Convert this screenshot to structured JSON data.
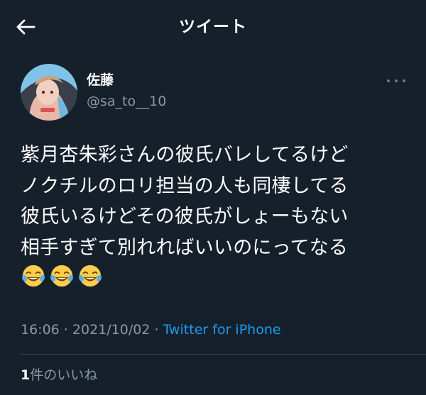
{
  "header": {
    "title": "ツイート",
    "back_icon": "arrow-left-icon"
  },
  "author": {
    "name": "佐藤",
    "handle": "@sa_to__10"
  },
  "tweet": {
    "lines": [
      "紫月杏朱彩さんの彼氏バレしてるけど",
      "ノクチルのロリ担当の人も同棲してる",
      "彼氏いるけどその彼氏がしょーもない",
      "相手すぎて別れればいいのにってなる"
    ],
    "emojis": [
      "face-with-tears-of-joy",
      "face-with-tears-of-joy",
      "face-with-tears-of-joy"
    ]
  },
  "meta": {
    "time": "16:06",
    "separator1": " · ",
    "date": "2021/10/02",
    "separator2": " · ",
    "source": "Twitter for iPhone"
  },
  "likes": {
    "count": "1",
    "label": "件のいいね"
  },
  "colors": {
    "background": "#15202b",
    "text_primary": "#ffffff",
    "text_secondary": "#8b98a5",
    "link": "#1d9bf0",
    "divider": "#38444d"
  }
}
